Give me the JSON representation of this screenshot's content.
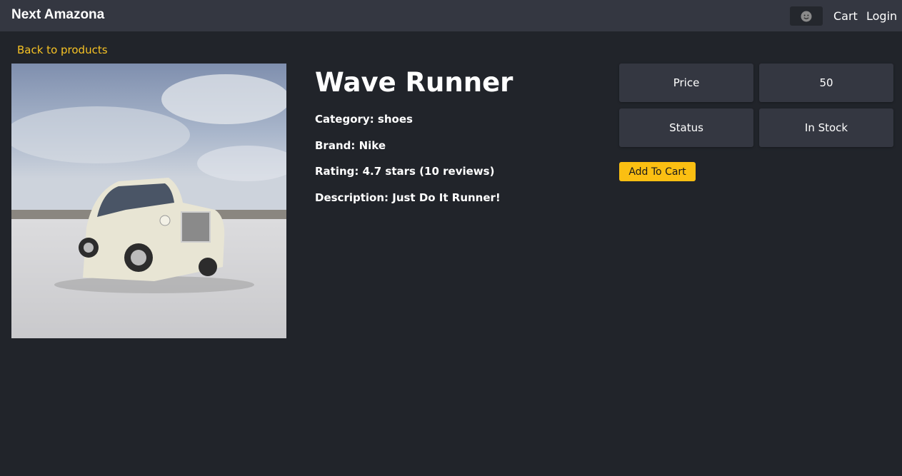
{
  "navbar": {
    "brand": "Next Amazona",
    "theme_icon": "face-icon",
    "cart_label": "Cart",
    "login_label": "Login"
  },
  "back_link": "Back to products",
  "product": {
    "image_alt": "Wave Runner",
    "image_subject": "white-luxury-car-photo",
    "name": "Wave Runner",
    "category": "Category: shoes",
    "brand": "Brand: Nike",
    "rating": "Rating: 4.7 stars (10 reviews)",
    "description": "Description: Just Do It Runner!"
  },
  "summary": {
    "price_label": "Price",
    "price_value": "50",
    "status_label": "Status",
    "status_value": "In Stock",
    "add_to_cart_label": "Add To Cart"
  },
  "colors": {
    "background": "#21242a",
    "navbar": "#343741",
    "accent_link": "#f6c224",
    "button": "#fbbf12"
  }
}
